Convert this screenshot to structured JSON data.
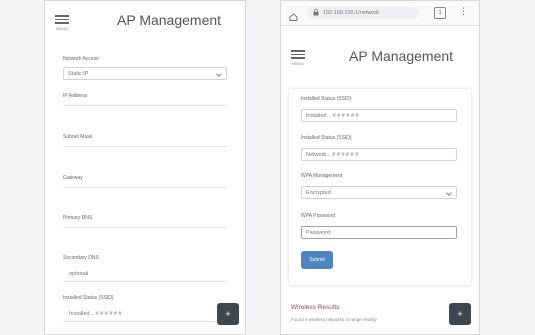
{
  "app_title": "AP Management",
  "menu_label": "MENU",
  "fab_symbol": "+",
  "left": {
    "select_label": "Network Access",
    "select_value": "Static IP",
    "fields": [
      {
        "label": "IP Address"
      },
      {
        "label": "Subnet Mask"
      },
      {
        "label": "Gateway"
      },
      {
        "label": "Primary DNS"
      },
      {
        "label": "Secondary DNS",
        "value": "optional"
      },
      {
        "label": "Installed Status (SSID)",
        "value": "Installed... # # # # # #"
      }
    ]
  },
  "right": {
    "browser": {
      "url": "192.168.100.1/network",
      "tab_count": "1",
      "more_icon": "⋮"
    },
    "fields": [
      {
        "label": "Installed Status (SSID)",
        "value": "Installed... # # # # # #"
      },
      {
        "label": "Installed Status (SSID)",
        "value": "Network... # # # # # #"
      }
    ],
    "wpa_label": "WPA Management",
    "wpa_value": "Encrypted",
    "password_label": "WPA Password",
    "password_placeholder": "Password",
    "submit_label": "Submit",
    "wireless_title": "Wireless Results",
    "wireless_text": "Found 4 wireless networks in range nearby"
  },
  "colors": {
    "fab": "#3d4750",
    "submit": "#4f86c2",
    "warning": "#b04646"
  },
  "icons": [
    "hamburger-icon",
    "home-icon",
    "lock-icon",
    "add-icon"
  ]
}
